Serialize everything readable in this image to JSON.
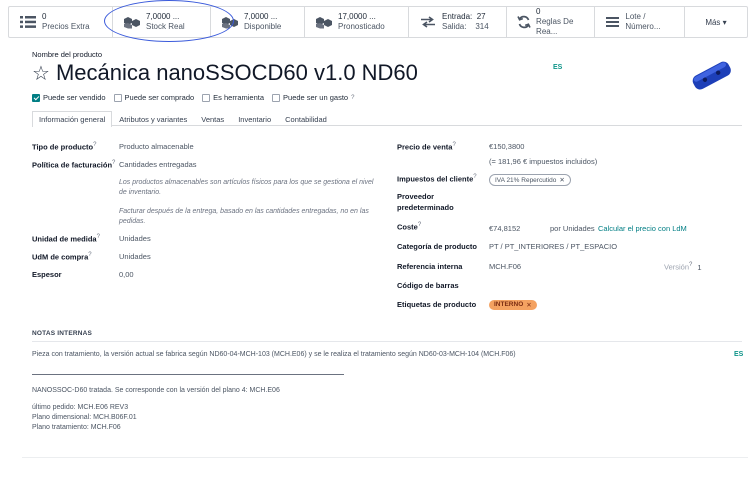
{
  "smart_buttons": [
    {
      "value": "0",
      "label": "Precios Extra",
      "icon": "list-icon"
    },
    {
      "value": "7,0000 ...",
      "label": "Stock Real",
      "icon": "cubes-icon"
    },
    {
      "value": "7,0000 ...",
      "label": "Disponible",
      "icon": "cubes-icon"
    },
    {
      "value": "17,0000 ...",
      "label": "Pronosticado",
      "icon": "cubes-icon"
    },
    {
      "value": "Entrada:  27",
      "label": "Salida:    314",
      "icon": "exchange-icon"
    },
    {
      "value": "0",
      "label": "Reglas De Rea...",
      "icon": "refresh-icon"
    },
    {
      "value": "",
      "label": "Lote / Número...",
      "icon": "bars-icon"
    },
    {
      "value": "",
      "label": "Más ▾",
      "icon": ""
    }
  ],
  "product": {
    "name_label": "Nombre del producto",
    "name": "Mecánica nanoSSOCD60 v1.0 ND60",
    "lang": "ES"
  },
  "checkboxes": [
    {
      "label": "Puede ser vendido",
      "checked": true
    },
    {
      "label": "Puede ser comprado",
      "checked": false
    },
    {
      "label": "Es herramienta",
      "checked": false
    },
    {
      "label": "Puede ser un gasto",
      "checked": false
    }
  ],
  "tabs": [
    "Información general",
    "Atributos y variantes",
    "Ventas",
    "Inventario",
    "Contabilidad"
  ],
  "left_fields": {
    "tipo_label": "Tipo de producto",
    "tipo_value": "Producto almacenable",
    "politica_label": "Política de facturación",
    "politica_value": "Cantidades entregadas",
    "help1": "Los productos almacenables son artículos físicos para los que se gestiona el nivel de inventario.",
    "help2": "Facturar después de la entrega, basado en las cantidades entregadas, no en las pedidas.",
    "udm_label": "Unidad de medida",
    "udm_value": "Unidades",
    "udm_compra_label": "UdM de compra",
    "udm_compra_value": "Unidades",
    "espesor_label": "Espesor",
    "espesor_value": "0,00"
  },
  "right_fields": {
    "precio_label": "Precio de venta",
    "precio_value": "€150,3800",
    "precio_tax": "(= 181,96 € impuestos incluidos)",
    "impuestos_label": "Impuestos del cliente",
    "impuestos_tag": "IVA 21% Repercutido",
    "proveedor_label": "Proveedor predeterminado",
    "coste_label": "Coste",
    "coste_value": "€74,8152",
    "coste_unit": "por Unidades",
    "coste_link": "Calcular el precio con LdM",
    "categoria_label": "Categoría de producto",
    "categoria_value": "PT / PT_INTERIORES / PT_ESPACIO",
    "referencia_label": "Referencia interna",
    "referencia_value": "MCH.F06",
    "version_label": "Versión",
    "version_value": "1",
    "barras_label": "Código de barras",
    "etiquetas_label": "Etiquetas de producto",
    "etiqueta_tag": "INTERNO"
  },
  "notes": {
    "header": "NOTAS INTERNAS",
    "line1": "Pieza con tratamiento, la versión actual se fabrica según ND60-04-MCH-103 (MCH.E06) y se le realiza el tratamiento según ND60-03-MCH-104 (MCH.F06)",
    "lang": "ES",
    "line2": "NANOSSOC-D60 tratada. Se corresponde con la versión del plano 4: MCH.E06",
    "line3": "último pedido: MCH.E06 REV3",
    "line4": "Plano dimensional: MCH.B06F.01",
    "line5": "Plano tratamiento: MCH.F06"
  },
  "colors": {
    "accent": "#017e84",
    "highlight_circle": "#3b5bdb",
    "tag_orange": "#f4a261"
  }
}
